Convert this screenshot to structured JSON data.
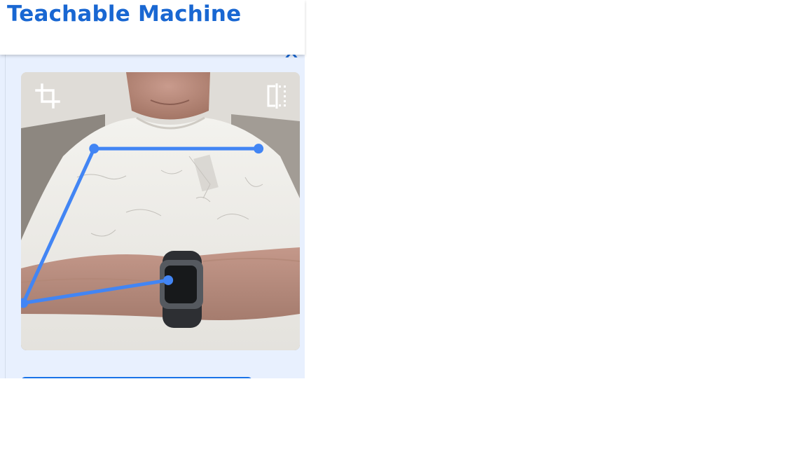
{
  "header": {
    "title": "Teachable Machine"
  },
  "panel": {
    "collapse_icon": "chevron-up-icon",
    "action_button_label": ""
  },
  "preview": {
    "crop_icon": "crop-icon",
    "flip_icon": "flip-horizontal-icon",
    "pose_keypoints": [
      {
        "name": "left-shoulder",
        "u": 0.262,
        "v": 0.275
      },
      {
        "name": "right-shoulder",
        "u": 0.852,
        "v": 0.275
      },
      {
        "name": "left-elbow",
        "u": 0.008,
        "v": 0.83
      },
      {
        "name": "left-wrist",
        "u": 0.528,
        "v": 0.748
      }
    ],
    "pose_connections": [
      [
        "left-shoulder",
        "right-shoulder"
      ],
      [
        "left-shoulder",
        "left-elbow"
      ],
      [
        "left-elbow",
        "left-wrist"
      ]
    ]
  },
  "colors": {
    "brand": "#1967d2",
    "skeleton": "#4285f4",
    "panel_background": "#e8f0fe",
    "button": "#1a73e8"
  }
}
